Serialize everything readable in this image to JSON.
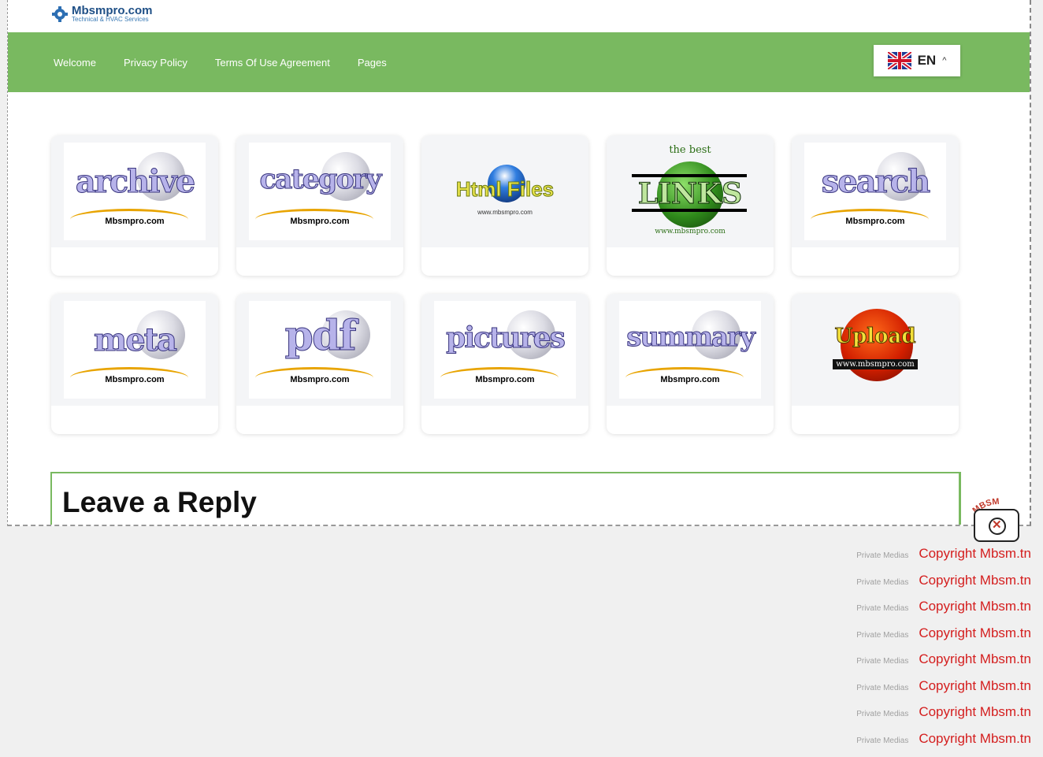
{
  "site": {
    "name": "Mbsmpro.com",
    "tagline": "Technical & HVAC Services"
  },
  "nav": {
    "links": [
      "Welcome",
      "Privacy Policy",
      "Terms Of Use Agreement",
      "Pages"
    ]
  },
  "language": {
    "code": "EN",
    "flag": "uk-flag-icon"
  },
  "cards": [
    {
      "word": "archive",
      "sub": "Mbsmpro.com"
    },
    {
      "word": "category",
      "sub": "Mbsmpro.com"
    },
    {
      "word": "Html Files",
      "sub": "www.mbsmpro.com"
    },
    {
      "word": "LINKS",
      "top": "the best",
      "sub": "www.mbsmpro.com"
    },
    {
      "word": "search",
      "sub": "Mbsmpro.com"
    },
    {
      "word": "meta",
      "sub": "Mbsmpro.com"
    },
    {
      "word": "pdf",
      "sub": "Mbsmpro.com"
    },
    {
      "word": "pictures",
      "sub": "Mbsmpro.com"
    },
    {
      "word": "summary",
      "sub": "Mbsmpro.com"
    },
    {
      "word": "Upload",
      "sub": "www.mbsmpro.com"
    }
  ],
  "reply": {
    "title": "Leave a Reply"
  },
  "watermark": {
    "arc_text": "MBSM"
  },
  "credits": [
    {
      "small": "Private Medias",
      "main": "Copyright Mbsm.tn"
    },
    {
      "small": "Private Medias",
      "main": "Copyright Mbsm.tn"
    },
    {
      "small": "Private Medias",
      "main": "Copyright Mbsm.tn"
    },
    {
      "small": "Private Medias",
      "main": "Copyright Mbsm.tn"
    },
    {
      "small": "Private Medias",
      "main": "Copyright Mbsm.tn"
    },
    {
      "small": "Private Medias",
      "main": "Copyright Mbsm.tn"
    },
    {
      "small": "Private Medias",
      "main": "Copyright Mbsm.tn"
    },
    {
      "small": "Private Medias",
      "main": "Copyright Mbsm.tn"
    }
  ],
  "colors": {
    "nav_green": "#79b960",
    "credit_red": "#d41e1e",
    "brand_blue": "#1e4f86"
  }
}
